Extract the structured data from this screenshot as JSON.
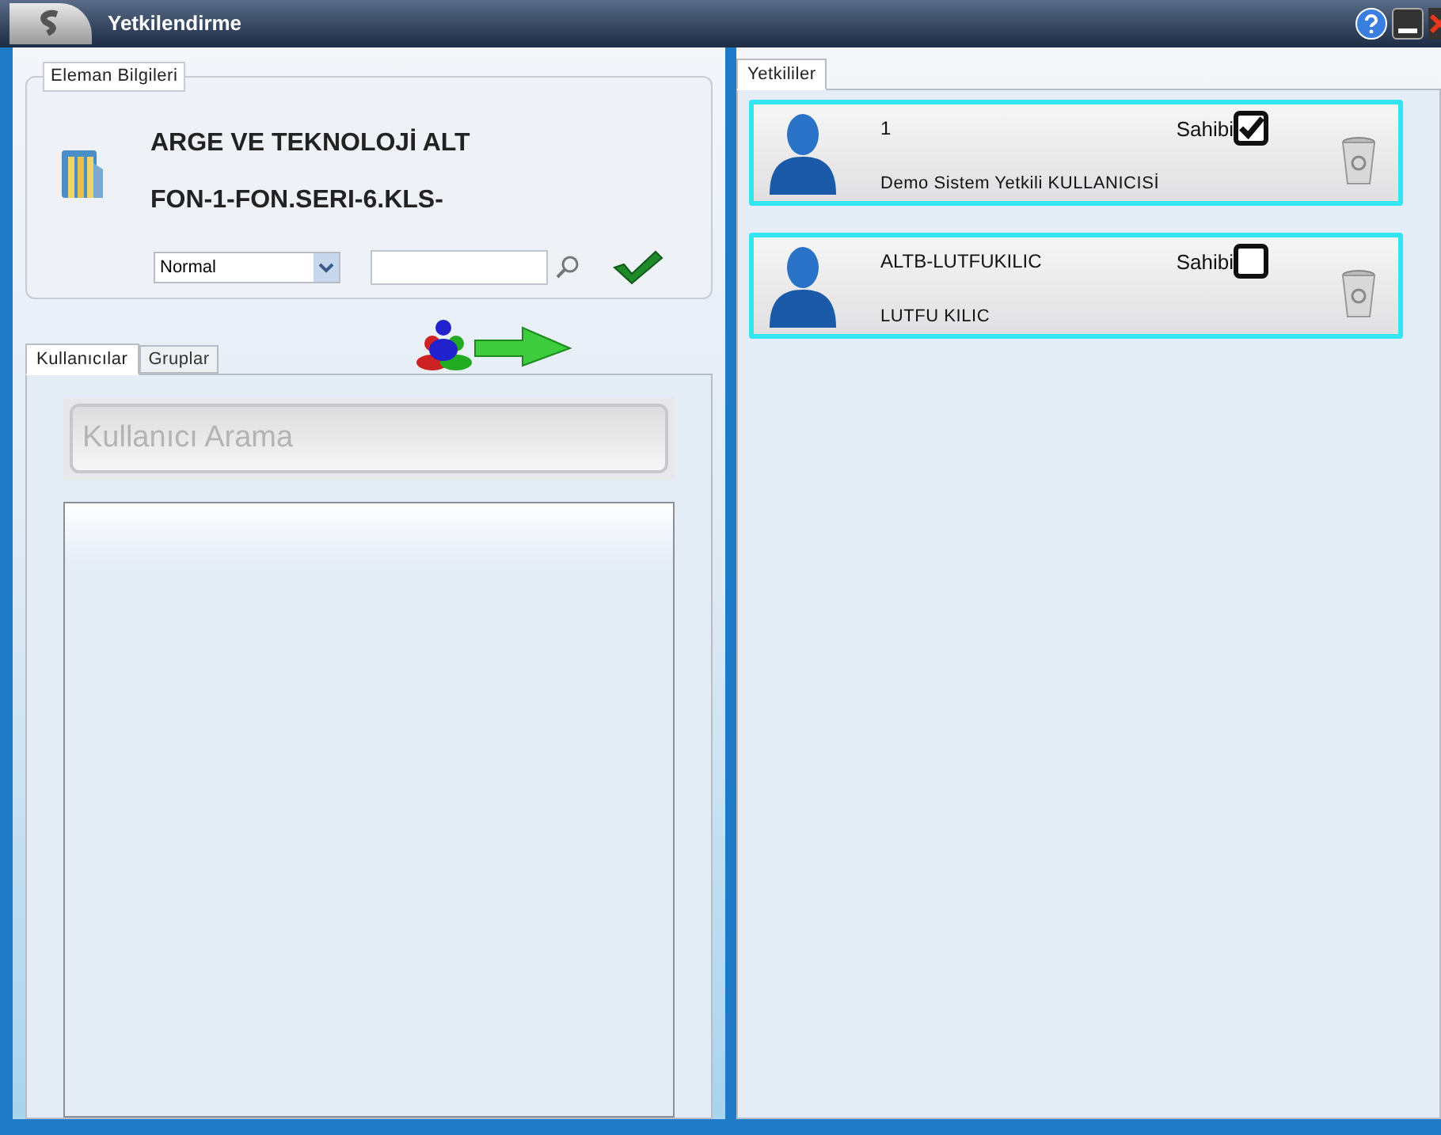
{
  "window": {
    "title": "Yetkilendirme"
  },
  "element_info": {
    "legend": "Eleman Bilgileri",
    "name_lines": [
      "ARGE VE TEKNOLOJİ ALT",
      "FON-1-FON.SERI-6.KLS-"
    ],
    "mode_select": {
      "value": "Normal"
    }
  },
  "left_tabs": [
    {
      "label": "Kullanıcılar",
      "selected": true
    },
    {
      "label": "Gruplar",
      "selected": false
    }
  ],
  "user_search": {
    "placeholder": "Kullanıcı Arama"
  },
  "right_tabs": [
    {
      "label": "Yetkililer",
      "selected": true
    }
  ],
  "authorized": [
    {
      "code": "1",
      "owner_label": "Sahibi",
      "owner": true,
      "full_name": "Demo Sistem Yetkili KULLANICISİ"
    },
    {
      "code": "ALTB-LUTFUKILIC",
      "owner_label": "Sahibi",
      "owner": false,
      "full_name": "LUTFU KILIC"
    }
  ]
}
